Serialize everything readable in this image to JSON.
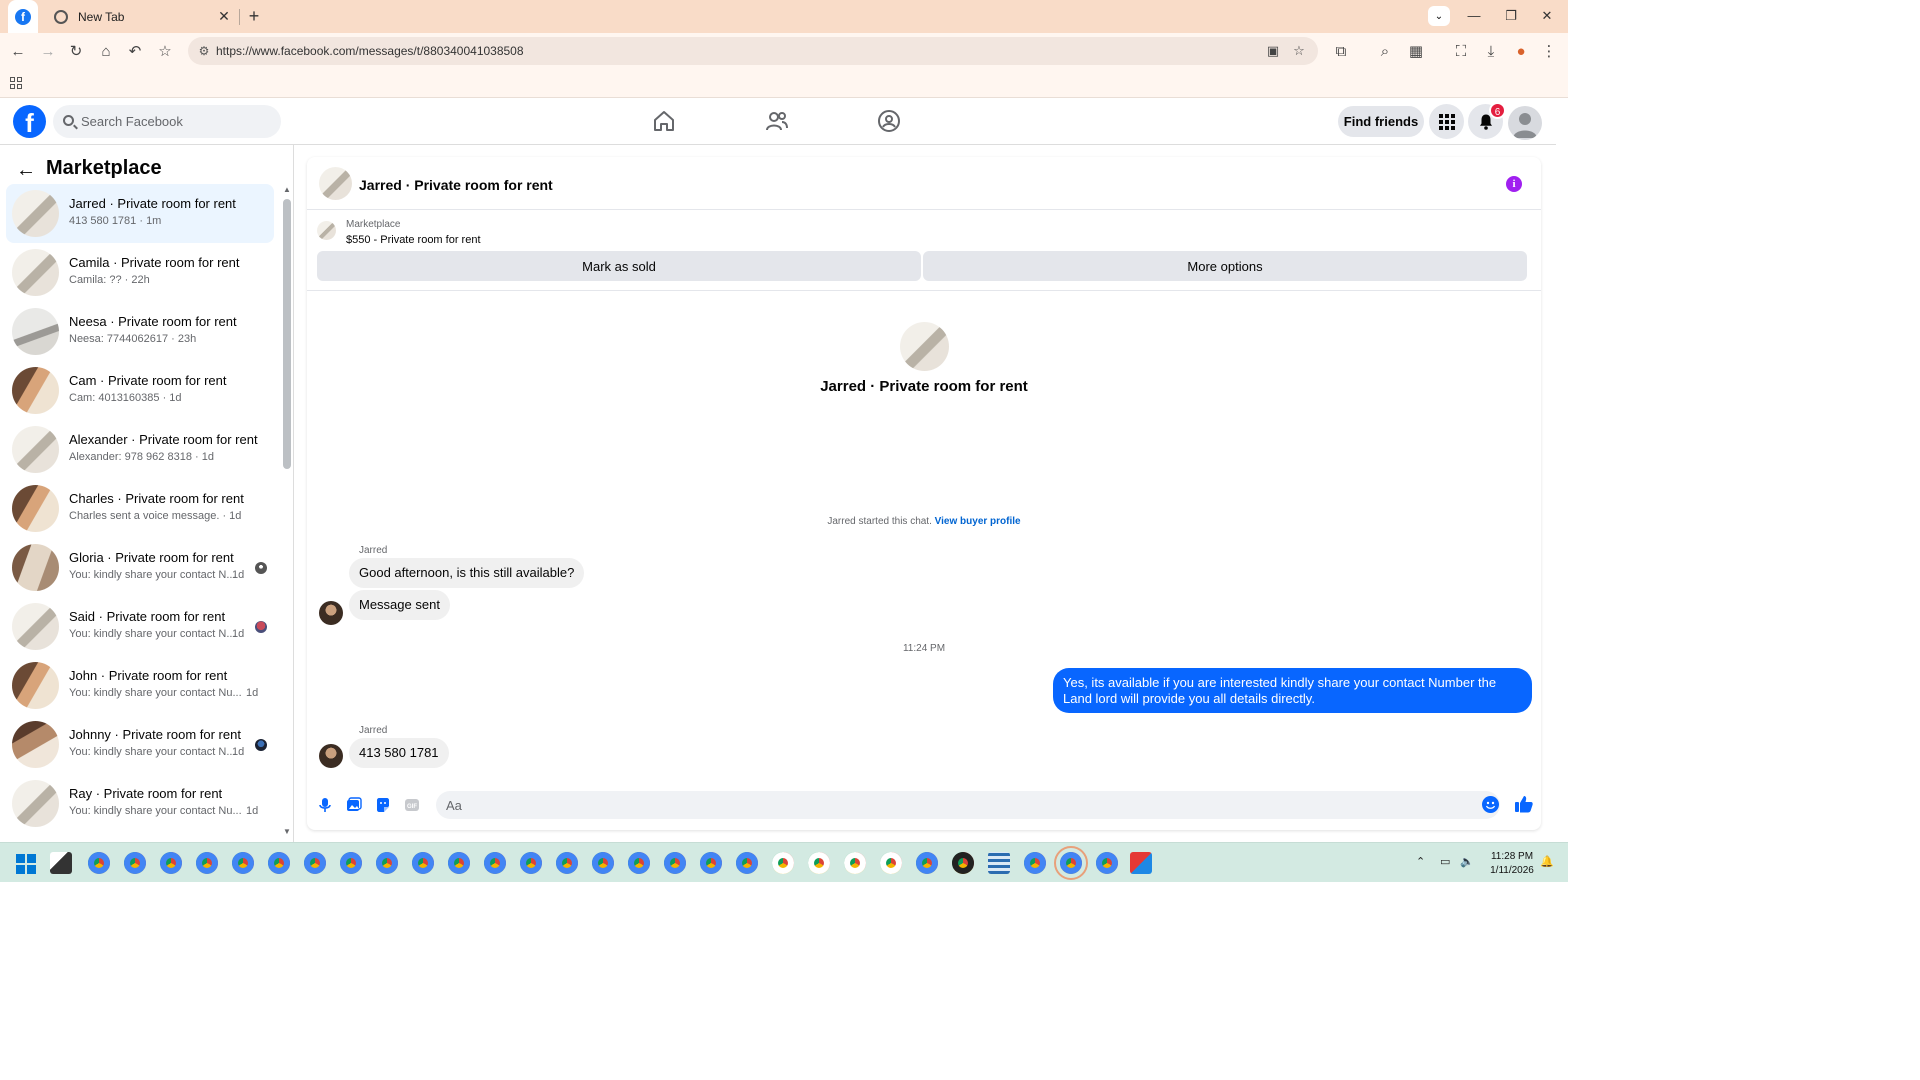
{
  "browser": {
    "tab_inactive_title": "New Tab",
    "url": "https://www.facebook.com/messages/t/880340041038508"
  },
  "header": {
    "search_placeholder": "Search Facebook",
    "find_friends_label": "Find friends",
    "notification_count": "6"
  },
  "sidebar": {
    "title": "Marketplace",
    "conversations": [
      {
        "name": "Jarred · Private room for rent",
        "preview": "413 580 1781 · 1m",
        "time": "",
        "active": true
      },
      {
        "name": "Camila · Private room for rent",
        "preview": "Camila: ?? · 22h",
        "time": ""
      },
      {
        "name": "Neesa · Private room for rent",
        "preview": "Neesa: 7744062617 · 23h",
        "time": ""
      },
      {
        "name": "Cam · Private room for rent",
        "preview": "Cam: 4013160385 · 1d",
        "time": ""
      },
      {
        "name": "Alexander · Private room for rent",
        "preview": "Alexander: 978 962 8318 · 1d",
        "time": ""
      },
      {
        "name": "Charles · Private room for rent",
        "preview": "Charles sent a voice message. · 1d",
        "time": ""
      },
      {
        "name": "Gloria · Private room for rent",
        "preview": "You: kindly share your contact N...",
        "time": "1d"
      },
      {
        "name": "Said · Private room for rent",
        "preview": "You: kindly share your contact N...",
        "time": "1d"
      },
      {
        "name": "John · Private room for rent",
        "preview": "You: kindly share your contact Nu...",
        "time": "1d"
      },
      {
        "name": "Johnny · Private room for rent",
        "preview": "You: kindly share your contact N...",
        "time": "1d"
      },
      {
        "name": "Ray · Private room for rent",
        "preview": "You: kindly share your contact Nu...",
        "time": "1d"
      }
    ]
  },
  "chat": {
    "header_name": "Jarred · Private room for rent",
    "marketplace_label": "Marketplace",
    "listing_title": "$550 - Private room for rent",
    "mark_sold_label": "Mark as sold",
    "more_options_label": "More options",
    "intro_name": "Jarred · Private room for rent",
    "started_text": "Jarred started this chat.",
    "view_profile_label": "View buyer profile",
    "messages": [
      {
        "sender": "Jarred",
        "text": "Good afternoon, is this still available?"
      },
      {
        "text": "Message sent"
      },
      {
        "timestamp": "11:24 PM"
      },
      {
        "text": "Yes, its available if you are interested kindly share your contact Number the Land lord will provide you all details directly."
      },
      {
        "sender": "Jarred",
        "text": "413 580 1781"
      }
    ],
    "composer_placeholder": "Aa"
  },
  "taskbar": {
    "time": "11:28 PM",
    "date": "1/11/2026"
  },
  "colors": {
    "fb_blue": "#0866ff",
    "active_row": "#ebf5ff",
    "bubble_in": "#f0f0f0",
    "tabstrip": "#f9dcc8",
    "info_purple": "#a020f0",
    "badge_red": "#e41e3f"
  }
}
